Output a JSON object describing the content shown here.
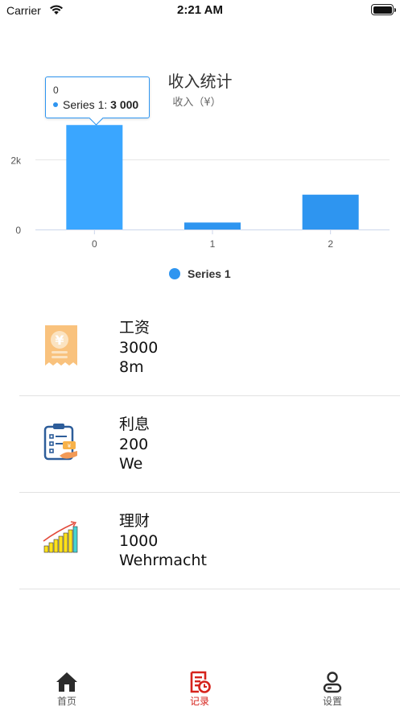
{
  "status_bar": {
    "carrier": "Carrier",
    "time": "2:21 AM"
  },
  "chart": {
    "title": "收入统计",
    "subtitle": "收入（¥）",
    "tooltip": {
      "header": "0",
      "series": "Series 1:",
      "value": "3 000"
    },
    "legend": "Series 1"
  },
  "chart_data": {
    "type": "bar",
    "categories": [
      "0",
      "1",
      "2"
    ],
    "series": [
      {
        "name": "Series 1",
        "values": [
          3000,
          200,
          1000
        ]
      }
    ],
    "title": "收入统计",
    "subtitle": "收入（¥）",
    "yticks": [
      "0",
      "2k"
    ],
    "ylim": [
      0,
      3000
    ],
    "grid": true,
    "legend_position": "bottom-center",
    "highlight_index": 0,
    "colors": {
      "bar": "#2e95f0",
      "bar_highlight": "#3aa6ff"
    }
  },
  "records": [
    {
      "category": "工资",
      "amount": "3000",
      "note": "8m",
      "icon": "salary-receipt-icon"
    },
    {
      "category": "利息",
      "amount": "200",
      "note": "We",
      "icon": "interest-clipboard-icon"
    },
    {
      "category": "理财",
      "amount": "1000",
      "note": "Wehrmacht",
      "icon": "investment-growth-icon"
    }
  ],
  "tabs": [
    {
      "label": "首页",
      "icon": "home-icon",
      "active": false
    },
    {
      "label": "记录",
      "icon": "record-icon",
      "active": true
    },
    {
      "label": "设置",
      "icon": "settings-user-icon",
      "active": false
    }
  ],
  "colors": {
    "accent": "#d6231c",
    "chart_blue": "#2e95f0"
  }
}
